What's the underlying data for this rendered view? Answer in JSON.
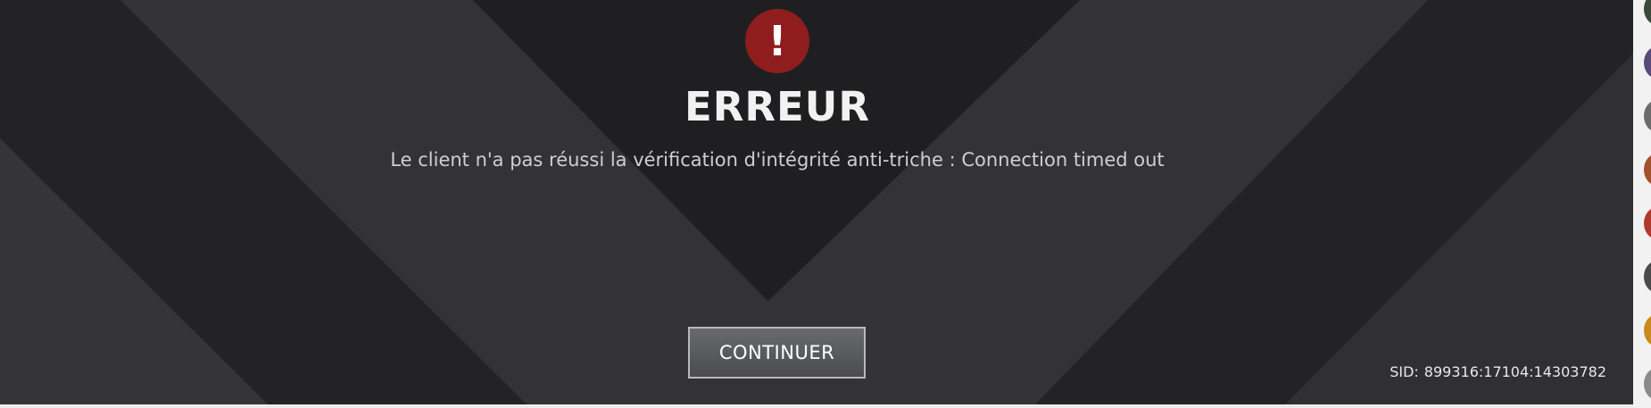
{
  "dialog": {
    "alert_icon": {
      "icon": "exclamation-icon",
      "glyph": "!",
      "color": "#8f1d1d"
    },
    "title": "ERREUR",
    "message": "Le client n'a pas réussi la vérification d'intégrité anti-triche : Connection timed out",
    "continue_label": "CONTINUER"
  },
  "session": {
    "label": "SID:",
    "id": "899316:17104:14303782"
  },
  "colors": {
    "background_dark": "#2b2b2d",
    "band_dark": "#222224",
    "band_light": "#343436",
    "accent_red": "#8f1d1d",
    "button_top": "#696a6e",
    "button_bottom": "#4b4c50"
  },
  "edge_strip": {
    "avatars": [
      {
        "icon": "avatar-icon",
        "color": "#3a4a3a"
      },
      {
        "icon": "avatar-icon",
        "color": "#5a4a7a"
      },
      {
        "icon": "avatar-icon",
        "color": "#6b6b6b"
      },
      {
        "icon": "avatar-icon",
        "color": "#a0522d"
      },
      {
        "icon": "avatar-icon",
        "color": "#b03a2e"
      },
      {
        "icon": "avatar-icon",
        "color": "#4a4a4a"
      },
      {
        "icon": "avatar-icon",
        "color": "#c98a1e"
      },
      {
        "icon": "avatar-icon",
        "color": "#8a8a8a"
      }
    ]
  }
}
